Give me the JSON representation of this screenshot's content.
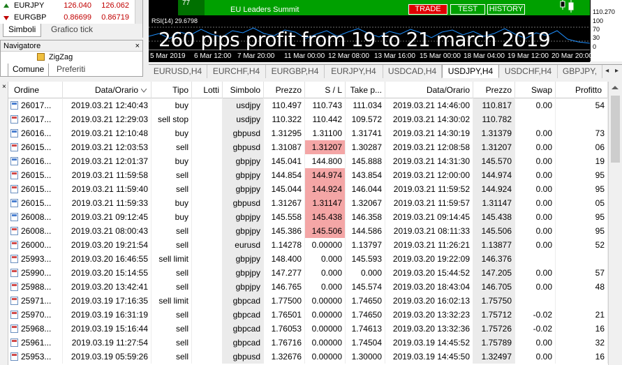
{
  "quotes": [
    {
      "symbol": "EURJPY",
      "bid": "126.040",
      "ask": "126.062",
      "dir": "up"
    },
    {
      "symbol": "EURGBP",
      "bid": "0.86699",
      "ask": "0.86719",
      "dir": "down"
    }
  ],
  "symbol_tabs": [
    "Simboli",
    "Grafico tick"
  ],
  "navigator": {
    "title": "Navigatore",
    "close": "×",
    "item": "ZigZag",
    "tabs": [
      "Comune",
      "Preferiti"
    ]
  },
  "news": {
    "count": "77",
    "title": "EU Leaders Summit",
    "trade": "TRADE",
    "test": "TEST",
    "history": "HISTORY"
  },
  "price_axis": [
    "110.270",
    "100",
    "70",
    "30",
    "0"
  ],
  "rsi_label": "RSI(14) 29.6798",
  "overlay_text": "260 pips profit from 19 to 21 march 2019",
  "time_labels": [
    "5 Mar 2019",
    "6 Mar 12:00",
    "7 Mar 20:00",
    "11 Mar 00:00",
    "12 Mar 08:00",
    "13 Mar 16:00",
    "15 Mar 00:00",
    "18 Mar 04:00",
    "19 Mar 12:00",
    "20 Mar 20:00"
  ],
  "chart_tabs": [
    "EURUSD,H4",
    "EURCHF,H4",
    "EURGBP,H4",
    "EURJPY,H4",
    "USDCAD,H4",
    "USDJPY,H4",
    "USDCHF,H4",
    "GBPJPY,"
  ],
  "chart_tabs_active": 5,
  "tab_scroll": "◂ ▸",
  "columns": [
    "Ordine",
    "Data/Orario",
    "Tipo",
    "Lotti",
    "Simbolo",
    "Prezzo",
    "S / L",
    "Take p...",
    "Data/Orario",
    "Prezzo",
    "Swap",
    "Profitto"
  ],
  "rows": [
    {
      "ordine": "26017...",
      "data": "2019.03.21 12:40:43",
      "tipo": "buy",
      "simbolo": "usdjpy",
      "prezzo": "110.497",
      "sl": "110.743",
      "tp": "111.034",
      "data2": "2019.03.21 14:46:00",
      "prezzo2": "110.817",
      "swap": "0.00",
      "profitto": "54",
      "sl_hit": false
    },
    {
      "ordine": "26017...",
      "data": "2019.03.21 12:29:03",
      "tipo": "sell stop",
      "simbolo": "usdjpy",
      "prezzo": "110.322",
      "sl": "110.442",
      "tp": "109.572",
      "data2": "2019.03.21 14:30:02",
      "prezzo2": "110.782",
      "swap": "",
      "profitto": "",
      "sl_hit": false
    },
    {
      "ordine": "26016...",
      "data": "2019.03.21 12:10:48",
      "tipo": "buy",
      "simbolo": "gbpusd",
      "prezzo": "1.31295",
      "sl": "1.31100",
      "tp": "1.31741",
      "data2": "2019.03.21 14:30:19",
      "prezzo2": "1.31379",
      "swap": "0.00",
      "profitto": "73",
      "sl_hit": false
    },
    {
      "ordine": "26015...",
      "data": "2019.03.21 12:03:53",
      "tipo": "sell",
      "simbolo": "gbpusd",
      "prezzo": "1.31087",
      "sl": "1.31207",
      "tp": "1.30287",
      "data2": "2019.03.21 12:08:58",
      "prezzo2": "1.31207",
      "swap": "0.00",
      "profitto": "06",
      "sl_hit": true
    },
    {
      "ordine": "26016...",
      "data": "2019.03.21 12:01:37",
      "tipo": "buy",
      "simbolo": "gbpjpy",
      "prezzo": "145.041",
      "sl": "144.800",
      "tp": "145.888",
      "data2": "2019.03.21 14:31:30",
      "prezzo2": "145.570",
      "swap": "0.00",
      "profitto": "19",
      "sl_hit": false
    },
    {
      "ordine": "26015...",
      "data": "2019.03.21 11:59:58",
      "tipo": "sell",
      "simbolo": "gbpjpy",
      "prezzo": "144.854",
      "sl": "144.974",
      "tp": "143.854",
      "data2": "2019.03.21 12:00:00",
      "prezzo2": "144.974",
      "swap": "0.00",
      "profitto": "95",
      "sl_hit": true
    },
    {
      "ordine": "26015...",
      "data": "2019.03.21 11:59:40",
      "tipo": "sell",
      "simbolo": "gbpjpy",
      "prezzo": "145.044",
      "sl": "144.924",
      "tp": "146.044",
      "data2": "2019.03.21 11:59:52",
      "prezzo2": "144.924",
      "swap": "0.00",
      "profitto": "95",
      "sl_hit": true
    },
    {
      "ordine": "26015...",
      "data": "2019.03.21 11:59:33",
      "tipo": "buy",
      "simbolo": "gbpusd",
      "prezzo": "1.31267",
      "sl": "1.31147",
      "tp": "1.32067",
      "data2": "2019.03.21 11:59:57",
      "prezzo2": "1.31147",
      "swap": "0.00",
      "profitto": "05",
      "sl_hit": true
    },
    {
      "ordine": "26008...",
      "data": "2019.03.21 09:12:45",
      "tipo": "buy",
      "simbolo": "gbpjpy",
      "prezzo": "145.558",
      "sl": "145.438",
      "tp": "146.358",
      "data2": "2019.03.21 09:14:45",
      "prezzo2": "145.438",
      "swap": "0.00",
      "profitto": "95",
      "sl_hit": true
    },
    {
      "ordine": "26008...",
      "data": "2019.03.21 08:00:43",
      "tipo": "sell",
      "simbolo": "gbpjpy",
      "prezzo": "145.386",
      "sl": "145.506",
      "tp": "144.586",
      "data2": "2019.03.21 08:11:33",
      "prezzo2": "145.506",
      "swap": "0.00",
      "profitto": "95",
      "sl_hit": true
    },
    {
      "ordine": "26000...",
      "data": "2019.03.20 19:21:54",
      "tipo": "sell",
      "simbolo": "eurusd",
      "prezzo": "1.14278",
      "sl": "0.00000",
      "tp": "1.13797",
      "data2": "2019.03.21 11:26:21",
      "prezzo2": "1.13877",
      "swap": "0.00",
      "profitto": "52",
      "sl_hit": false
    },
    {
      "ordine": "25993...",
      "data": "2019.03.20 16:46:55",
      "tipo": "sell limit",
      "simbolo": "gbpjpy",
      "prezzo": "148.400",
      "sl": "0.000",
      "tp": "145.593",
      "data2": "2019.03.20 19:22:09",
      "prezzo2": "146.376",
      "swap": "",
      "profitto": "",
      "sl_hit": false
    },
    {
      "ordine": "25990...",
      "data": "2019.03.20 15:14:55",
      "tipo": "sell",
      "simbolo": "gbpjpy",
      "prezzo": "147.277",
      "sl": "0.000",
      "tp": "0.000",
      "data2": "2019.03.20 15:44:52",
      "prezzo2": "147.205",
      "swap": "0.00",
      "profitto": "57",
      "sl_hit": false
    },
    {
      "ordine": "25988...",
      "data": "2019.03.20 13:42:41",
      "tipo": "sell",
      "simbolo": "gbpjpy",
      "prezzo": "146.765",
      "sl": "0.000",
      "tp": "145.574",
      "data2": "2019.03.20 18:43:04",
      "prezzo2": "146.705",
      "swap": "0.00",
      "profitto": "48",
      "sl_hit": false
    },
    {
      "ordine": "25971...",
      "data": "2019.03.19 17:16:35",
      "tipo": "sell limit",
      "simbolo": "gbpcad",
      "prezzo": "1.77500",
      "sl": "0.00000",
      "tp": "1.74650",
      "data2": "2019.03.20 16:02:13",
      "prezzo2": "1.75750",
      "swap": "",
      "profitto": "",
      "sl_hit": false
    },
    {
      "ordine": "25970...",
      "data": "2019.03.19 16:31:19",
      "tipo": "sell",
      "simbolo": "gbpcad",
      "prezzo": "1.76501",
      "sl": "0.00000",
      "tp": "1.74650",
      "data2": "2019.03.20 13:32:23",
      "prezzo2": "1.75712",
      "swap": "-0.02",
      "profitto": "21",
      "sl_hit": false
    },
    {
      "ordine": "25968...",
      "data": "2019.03.19 15:16:44",
      "tipo": "sell",
      "simbolo": "gbpcad",
      "prezzo": "1.76053",
      "sl": "0.00000",
      "tp": "1.74613",
      "data2": "2019.03.20 13:32:36",
      "prezzo2": "1.75726",
      "swap": "-0.02",
      "profitto": "16",
      "sl_hit": false
    },
    {
      "ordine": "25961...",
      "data": "2019.03.19 11:27:54",
      "tipo": "sell",
      "simbolo": "gbpcad",
      "prezzo": "1.76716",
      "sl": "0.00000",
      "tp": "1.74504",
      "data2": "2019.03.19 14:45:52",
      "prezzo2": "1.75789",
      "swap": "0.00",
      "profitto": "32",
      "sl_hit": false
    },
    {
      "ordine": "25953...",
      "data": "2019.03.19 05:59:26",
      "tipo": "sell",
      "simbolo": "gbpusd",
      "prezzo": "1.32676",
      "sl": "0.00000",
      "tp": "1.30000",
      "data2": "2019.03.19 14:45:50",
      "prezzo2": "1.32497",
      "swap": "0.00",
      "profitto": "16",
      "sl_hit": false
    }
  ],
  "colors": {
    "sl_hit": "#f4a6a6",
    "bid_ask": "#c00000",
    "news_bar": "#00a000",
    "trade_btn": "#e00000"
  }
}
